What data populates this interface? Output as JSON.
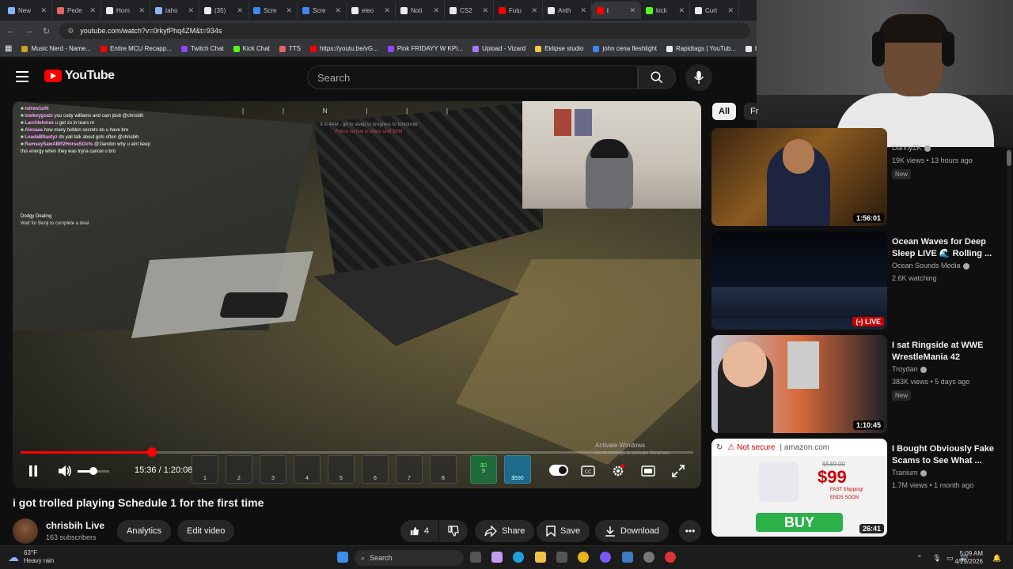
{
  "browser": {
    "tabs": [
      {
        "label": "New",
        "color": "#8ab4f8"
      },
      {
        "label": "Pede",
        "color": "#e06666"
      },
      {
        "label": "Hom",
        "color": "#e8eaed"
      },
      {
        "label": "taho",
        "color": "#8ab4f8"
      },
      {
        "label": "(35)",
        "color": "#e8eaed"
      },
      {
        "label": "Scre",
        "color": "#4285f4"
      },
      {
        "label": "Scre",
        "color": "#4285f4"
      },
      {
        "label": "eleo",
        "color": "#e8eaed"
      },
      {
        "label": "Noti",
        "color": "#e8eaed"
      },
      {
        "label": "CS2",
        "color": "#e8eaed"
      },
      {
        "label": "Futu",
        "color": "#ff0000"
      },
      {
        "label": "Anth",
        "color": "#e8eaed"
      },
      {
        "label": "i",
        "color": "#ff0000",
        "active": true
      },
      {
        "label": "kick",
        "color": "#53fc18"
      },
      {
        "label": "Curt",
        "color": "#e8eaed"
      }
    ],
    "url": "youtube.com/watch?v=0rkyfPhq4ZM&t=934s",
    "bookmarks": [
      {
        "label": "Music Nerd - Name...",
        "color": "#c9a227"
      },
      {
        "label": "Entire MCU Recapp...",
        "color": "#ff0000"
      },
      {
        "label": "Twitch Chat",
        "color": "#9146ff"
      },
      {
        "label": "Kick Chat",
        "color": "#53fc18"
      },
      {
        "label": "TTS",
        "color": "#e06666"
      },
      {
        "label": "https://youtu.be/vG...",
        "color": "#ff0000"
      },
      {
        "label": "Pink FRIDAYY W KPI...",
        "color": "#9146ff"
      },
      {
        "label": "Upload - Vizard",
        "color": "#b072ff"
      },
      {
        "label": "Eklipse studio",
        "color": "#f2c94c"
      },
      {
        "label": "john cena fleshlight",
        "color": "#4285f4"
      },
      {
        "label": "Rapidtags | YouTub...",
        "color": "#e8eaed"
      },
      {
        "label": "bih links",
        "color": "#e8eaed"
      }
    ]
  },
  "youtube": {
    "logo_text": "YouTube",
    "search_placeholder": "Search"
  },
  "game": {
    "chat": [
      {
        "user": "ndrew1ofit",
        "msg": ""
      },
      {
        "user": "lowkeygoatz",
        "msg": "you cody williams and cam jdub @chrisbih"
      },
      {
        "user": "Larchlehmez",
        "msg": "u got zo in tears rn"
      },
      {
        "user": "Alexaaa",
        "msg": "how many hidden secrets do u have bro"
      },
      {
        "user": "LoadaBNastyz",
        "msg": "do yall talk about girls often @chrisbih"
      },
      {
        "user": "RamseySawABR2HorseSGirls",
        "msg": "@1landon why u aint keep this energy when they was tryna cancel u bro"
      }
    ],
    "hud_compass": "N",
    "hud_message_1": "It is 4AM - go to sleep to progress to tomorrow",
    "hud_message_2": "Police curfew in effect until 5AM",
    "deal_title": "Dodgy Dealing",
    "deal_text": "Wait for Benji to complete a deal",
    "cash": "$0",
    "card": "$590",
    "slots": [
      "1",
      "2",
      "3",
      "4",
      "5",
      "6",
      "7",
      "8",
      "9"
    ],
    "watermark_title": "Activate Windows",
    "watermark_sub": "Go to Settings to activate Windows."
  },
  "player": {
    "current_time": "15:36",
    "total_time": "1:20:08",
    "time_display": "15:36 / 1:20:08",
    "progress_fraction": 0.195,
    "volume_fraction": 0.5
  },
  "video": {
    "title": "i got trolled playing Schedule 1 for the first time",
    "channel": "chrisbih Live",
    "subscribers": "163 subscribers",
    "analytics_label": "Analytics",
    "edit_label": "Edit video",
    "likes": "4",
    "share_label": "Share",
    "save_label": "Save",
    "download_label": "Download"
  },
  "sidebar": {
    "chip_all": "All",
    "chip_next": "Fr",
    "recs": [
      {
        "title": "",
        "channel": "DannyZK",
        "meta": "19K views • 13 hours ago",
        "badge": "New",
        "duration": "1:56:01",
        "thumb": "rings"
      },
      {
        "title": "Ocean Waves for Deep Sleep LIVE 🌊 Rolling ...",
        "channel": "Ocean Sounds Media",
        "meta": "2.6K watching",
        "badge": "",
        "duration": "LIVE",
        "thumb": "ocean"
      },
      {
        "title": "I sat Ringside at WWE WrestleMania 42",
        "channel": "Troydan",
        "meta": "383K views • 5 days ago",
        "badge": "New",
        "duration": "1:10:45",
        "thumb": "wwe"
      },
      {
        "title": "I Bought Obviously Fake Scams to See What ...",
        "channel": "Tranium",
        "meta": "1.7M views • 1 month ago",
        "badge": "",
        "duration": "26:41",
        "thumb": "amazon",
        "thumb_text": {
          "not_secure": "Not secure",
          "domain": "amazon.com",
          "old_price": "$549.00",
          "price": "$99",
          "fast_shipping": "FAST Shipping!",
          "ends_soon": "ENDS SOON",
          "buy": "BUY"
        }
      }
    ]
  },
  "taskbar": {
    "temp": "63°F",
    "weather": "Heavy rain",
    "search": "Search",
    "time": "5:09 AM",
    "date": "4/29/2026"
  },
  "colors": {
    "accent": "#ff0000",
    "bg": "#0f0f0f"
  }
}
